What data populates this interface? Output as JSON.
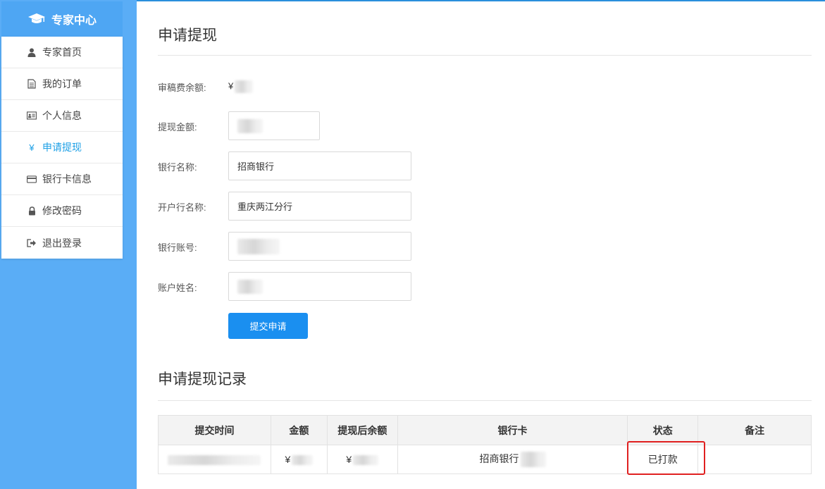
{
  "sidebar": {
    "title": "专家中心",
    "items": [
      {
        "label": "专家首页",
        "icon": "user-icon"
      },
      {
        "label": "我的订单",
        "icon": "document-icon"
      },
      {
        "label": "个人信息",
        "icon": "id-card-icon"
      },
      {
        "label": "申请提现",
        "icon": "yen-icon"
      },
      {
        "label": "银行卡信息",
        "icon": "credit-card-icon"
      },
      {
        "label": "修改密码",
        "icon": "lock-icon"
      },
      {
        "label": "退出登录",
        "icon": "logout-icon"
      }
    ],
    "active_index": 3,
    "colors": {
      "sidebar_bg": "#5aadf6",
      "active": "#1ea0e6"
    }
  },
  "withdraw": {
    "title": "申请提现",
    "balance_label": "审稿费余额:",
    "balance_prefix": "¥",
    "amount_label": "提现金额:",
    "bank_name_label": "银行名称:",
    "bank_name_value": "招商银行",
    "branch_label": "开户行名称:",
    "branch_value": "重庆两江分行",
    "account_label": "银行账号:",
    "holder_label": "账户姓名:",
    "submit_label": "提交申请"
  },
  "records": {
    "title": "申请提现记录",
    "columns": [
      "提交时间",
      "金额",
      "提现后余额",
      "银行卡",
      "状态",
      "备注"
    ],
    "rows": [
      {
        "amount_prefix": "¥",
        "balance_prefix": "¥",
        "bank_card": "招商银行",
        "status": "已打款",
        "note": ""
      }
    ],
    "status_color": "#6dbb4a"
  }
}
